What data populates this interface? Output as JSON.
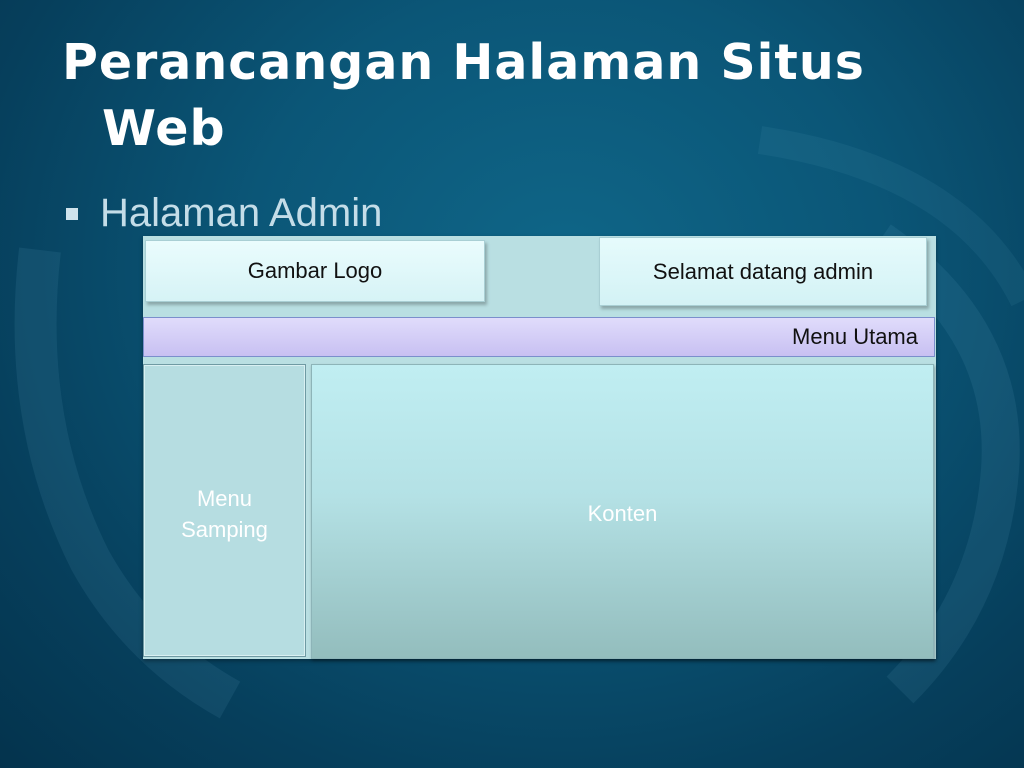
{
  "slide": {
    "title_line1": "Perancangan Halaman Situs",
    "title_line2": "Web",
    "bullet": "Halaman Admin"
  },
  "layout_diagram": {
    "logo_label": "Gambar Logo",
    "welcome_label": "Selamat datang admin",
    "main_menu_label": "Menu Utama",
    "side_menu_line1": "Menu",
    "side_menu_line2": "Samping",
    "content_label": "Konten"
  },
  "colors": {
    "background": "#0b5677",
    "title_text": "#ffffff",
    "bullet_text": "#c4dde8",
    "diagram_frame": "#b9dfe2",
    "main_menu_bar": "#c8c0f2",
    "content_box": "#b4e1e5"
  },
  "icons": {
    "bullet": "square-bullet-icon"
  }
}
